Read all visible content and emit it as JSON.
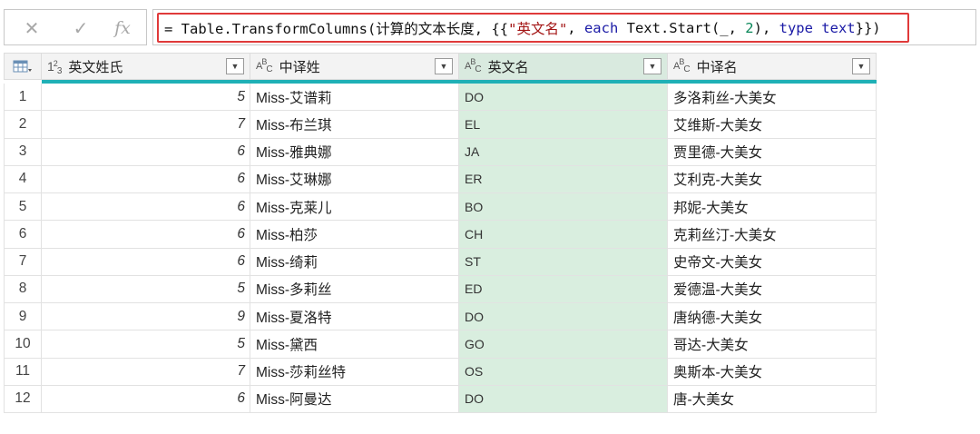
{
  "formula_bar": {
    "cancel_icon": "✕",
    "commit_icon": "✓",
    "fx_label": "fx",
    "formula_tokens": [
      {
        "t": "= Table.TransformColumns(计算的文本长度, {{",
        "k": "fn"
      },
      {
        "t": "\"英文名\"",
        "k": "str"
      },
      {
        "t": ", ",
        "k": "fn"
      },
      {
        "t": "each",
        "k": "kw"
      },
      {
        "t": " Text.Start(_, ",
        "k": "fn"
      },
      {
        "t": "2",
        "k": "num"
      },
      {
        "t": "), ",
        "k": "fn"
      },
      {
        "t": "type",
        "k": "kw"
      },
      {
        "t": " ",
        "k": "fn"
      },
      {
        "t": "text",
        "k": "kw"
      },
      {
        "t": "}})",
        "k": "fn"
      }
    ]
  },
  "table": {
    "columns": [
      {
        "label": "英文姓氏",
        "type": "number",
        "icon_text": "123"
      },
      {
        "label": "中译姓",
        "type": "text",
        "icon_text": "ABC"
      },
      {
        "label": "英文名",
        "type": "text",
        "icon_text": "ABC"
      },
      {
        "label": "中译名",
        "type": "text",
        "icon_text": "ABC"
      }
    ],
    "selected_column": "英文名",
    "accent_color": "#1fb0b6",
    "selected_fill": "#d9eedf",
    "rows": [
      {
        "n": "1",
        "a": "5",
        "b": "Miss-艾谱莉",
        "c": "DO",
        "d": "多洛莉丝-大美女"
      },
      {
        "n": "2",
        "a": "7",
        "b": "Miss-布兰琪",
        "c": "EL",
        "d": "艾维斯-大美女"
      },
      {
        "n": "3",
        "a": "6",
        "b": "Miss-雅典娜",
        "c": "JA",
        "d": "贾里德-大美女"
      },
      {
        "n": "4",
        "a": "6",
        "b": "Miss-艾琳娜",
        "c": "ER",
        "d": "艾利克-大美女"
      },
      {
        "n": "5",
        "a": "6",
        "b": "Miss-克莱儿",
        "c": "BO",
        "d": "邦妮-大美女"
      },
      {
        "n": "6",
        "a": "6",
        "b": "Miss-柏莎",
        "c": "CH",
        "d": "克莉丝汀-大美女"
      },
      {
        "n": "7",
        "a": "6",
        "b": "Miss-绮莉",
        "c": "ST",
        "d": "史帝文-大美女"
      },
      {
        "n": "8",
        "a": "5",
        "b": "Miss-多莉丝",
        "c": "ED",
        "d": "爱德温-大美女"
      },
      {
        "n": "9",
        "a": "9",
        "b": "Miss-夏洛特",
        "c": "DO",
        "d": "唐纳德-大美女"
      },
      {
        "n": "10",
        "a": "5",
        "b": "Miss-黛西",
        "c": "GO",
        "d": "哥达-大美女"
      },
      {
        "n": "11",
        "a": "7",
        "b": "Miss-莎莉丝特",
        "c": "OS",
        "d": "奥斯本-大美女"
      },
      {
        "n": "12",
        "a": "6",
        "b": "Miss-阿曼达",
        "c": "DO",
        "d": "唐-大美女"
      }
    ]
  }
}
